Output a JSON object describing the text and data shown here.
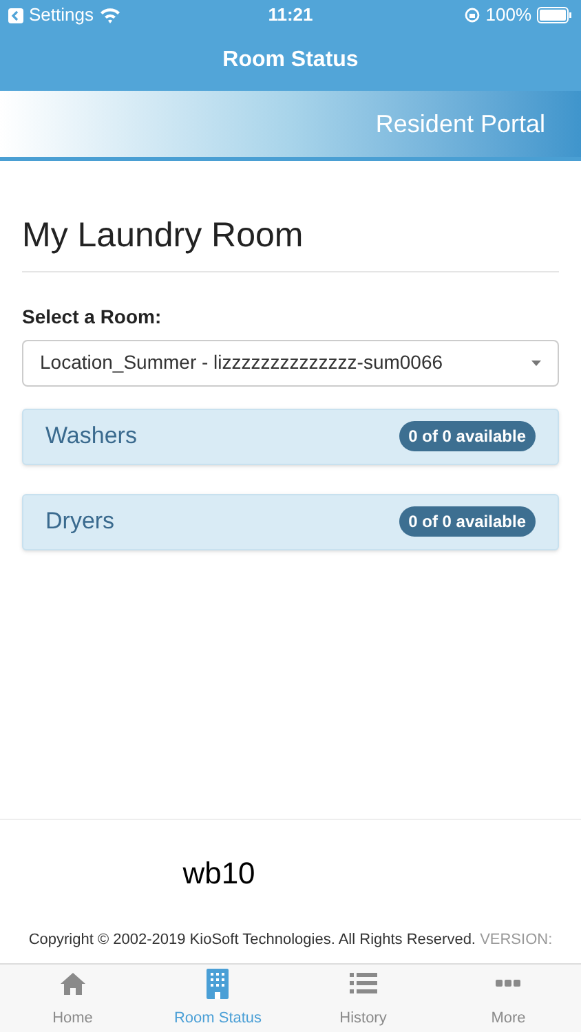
{
  "status_bar": {
    "back_label": "Settings",
    "time": "11:21",
    "battery": "100%"
  },
  "nav_bar": {
    "title": "Room Status"
  },
  "banner": {
    "title": "Resident Portal"
  },
  "page": {
    "heading": "My Laundry Room",
    "room_label": "Select a Room:",
    "room_value": "Location_Summer - lizzzzzzzzzzzzzz-sum0066"
  },
  "panels": [
    {
      "title": "Washers",
      "badge": "0 of 0 available"
    },
    {
      "title": "Dryers",
      "badge": "0 of 0 available"
    }
  ],
  "footer": {
    "code": "wb10",
    "copyright": "Copyright © 2002-2019 KioSoft Technologies. All Rights Reserved.",
    "version_label": "VERSION:"
  },
  "tab_bar": [
    {
      "label": "Home",
      "kind": "home",
      "selected": false
    },
    {
      "label": "Room Status",
      "kind": "building",
      "selected": true
    },
    {
      "label": "History",
      "kind": "list",
      "selected": false
    },
    {
      "label": "More",
      "kind": "more",
      "selected": false
    }
  ]
}
